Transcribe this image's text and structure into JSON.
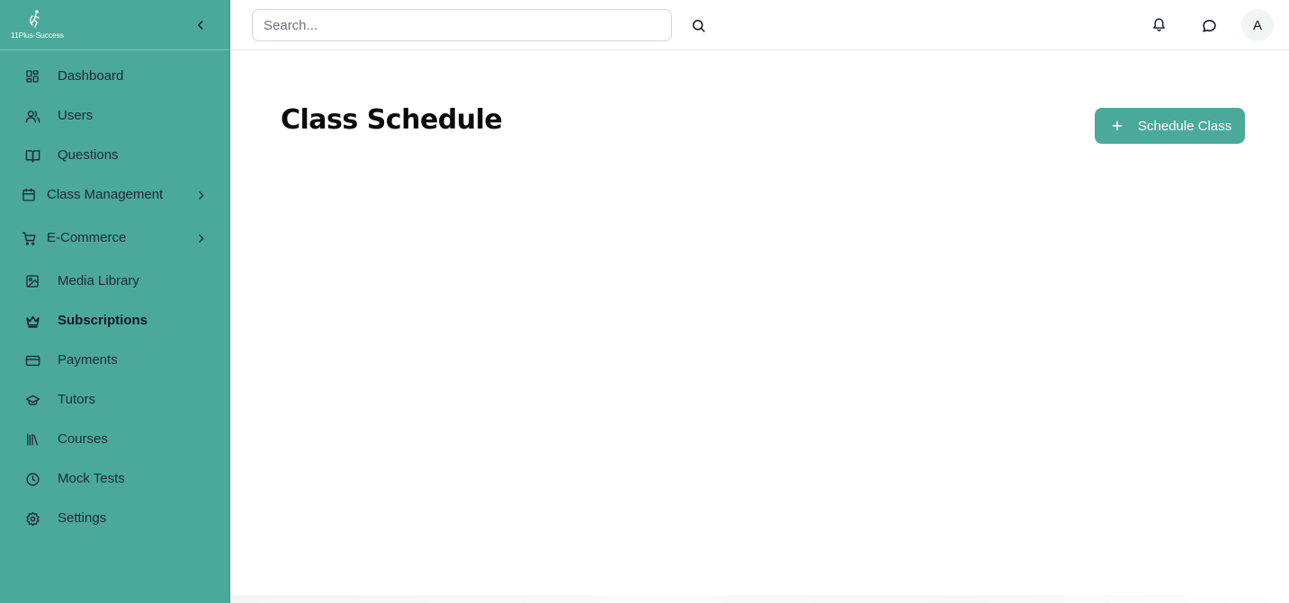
{
  "sidebar": {
    "logo_text": "11Plus-Success",
    "items": [
      {
        "label": "Dashboard",
        "icon": "dashboard-grid-icon"
      },
      {
        "label": "Users",
        "icon": "users-icon"
      },
      {
        "label": "Questions",
        "icon": "book-open-icon"
      },
      {
        "label": "Class Management",
        "icon": "calendar-icon",
        "expandable": true
      },
      {
        "label": "E-Commerce",
        "icon": "shopping-cart-icon",
        "expandable": true
      },
      {
        "label": "Media Library",
        "icon": "image-icon"
      },
      {
        "label": "Subscriptions",
        "icon": "crown-icon",
        "active": true
      },
      {
        "label": "Payments",
        "icon": "credit-card-icon"
      },
      {
        "label": "Tutors",
        "icon": "graduation-cap-icon"
      },
      {
        "label": "Courses",
        "icon": "library-icon"
      },
      {
        "label": "Mock Tests",
        "icon": "clock-icon"
      },
      {
        "label": "Settings",
        "icon": "gear-icon"
      }
    ]
  },
  "topbar": {
    "search_placeholder": "Search...",
    "avatar_initial": "A"
  },
  "main": {
    "title": "Class Schedule",
    "schedule_button_label": "Schedule Class"
  },
  "colors": {
    "brand": "#4aa99a",
    "text": "#1f2937"
  }
}
